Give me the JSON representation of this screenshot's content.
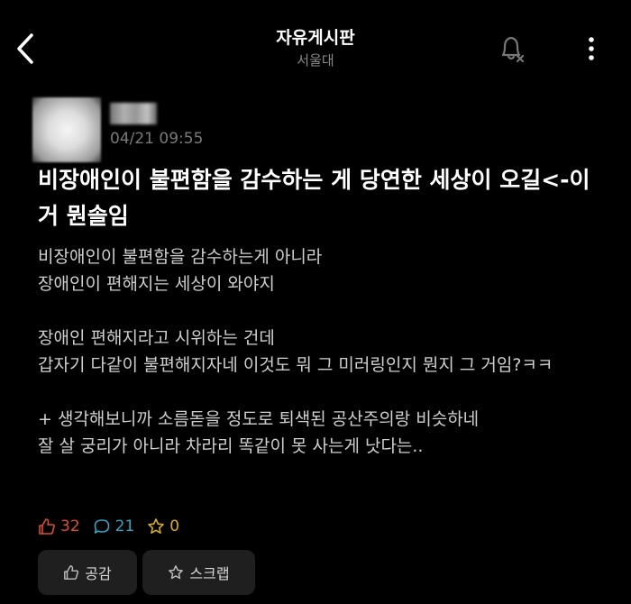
{
  "header": {
    "title": "자유게시판",
    "subtitle": "서울대",
    "back_icon": "chevron-left-icon",
    "bell_icon": "bell-off-icon",
    "more_icon": "more-vertical-icon"
  },
  "post": {
    "date": "04/21 09:55",
    "title": "비장애인이 불편함을 감수하는 게 당연한 세상이 오길<-이거 뭔솔임",
    "body": "비장애인이 불편함을 감수하는게 아니라\n장애인이 편해지는 세상이 와야지\n\n장애인 편해지라고 시위하는 건데\n갑자기 다같이 불편해지자네 이것도 뭐 그 미러링인지 뭔지 그 거임?ㅋㅋ\n\n+ 생각해보니까 소름돋을 정도로 퇴색된 공산주의랑 비슷하네\n잘 살 궁리가 아니라 차라리 똑같이 못 사는게 낫다는.."
  },
  "stats": {
    "likes": "32",
    "comments": "21",
    "scraps": "0"
  },
  "actions": {
    "like_label": "공감",
    "scrap_label": "스크랩"
  },
  "colors": {
    "background": "#000000",
    "like": "#e04a2e",
    "comment": "#2aa6c7",
    "scrap": "#d8ae1a",
    "button_bg": "#1f1f1f"
  }
}
